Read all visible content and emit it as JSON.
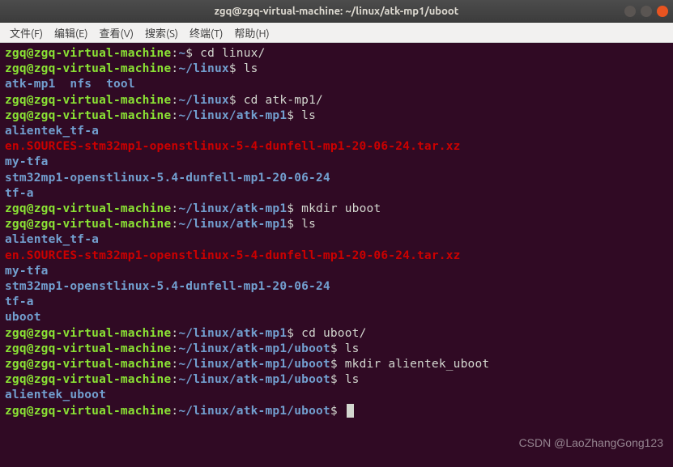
{
  "titlebar": {
    "title": "zgq@zgq-virtual-machine: ~/linux/atk-mp1/uboot"
  },
  "menubar": {
    "items": [
      "文件(F)",
      "编辑(E)",
      "查看(V)",
      "搜索(S)",
      "终端(T)",
      "帮助(H)"
    ]
  },
  "prompt": {
    "userhost": "zgq@zgq-virtual-machine",
    "sep": ":",
    "dollar": "$"
  },
  "paths": {
    "home": "~",
    "linux": "~/linux",
    "atkmp1": "~/linux/atk-mp1",
    "uboot": "~/linux/atk-mp1/uboot"
  },
  "cmds": {
    "cd_linux": "cd linux/",
    "ls": "ls",
    "cd_atkmp1": "cd atk-mp1/",
    "mkdir_uboot": "mkdir uboot",
    "cd_uboot": "cd uboot/",
    "mkdir_alientek_uboot": "mkdir alientek_uboot"
  },
  "listings": {
    "linux": {
      "d0": "atk-mp1",
      "d1": "nfs",
      "d2": "tool"
    },
    "atkmp1_before": {
      "d0": "alientek_tf-a",
      "a0": "en.SOURCES-stm32mp1-openstlinux-5-4-dunfell-mp1-20-06-24.tar.xz",
      "d1": "my-tfa",
      "d2": "stm32mp1-openstlinux-5.4-dunfell-mp1-20-06-24",
      "d3": "tf-a"
    },
    "atkmp1_after": {
      "d0": "alientek_tf-a",
      "a0": "en.SOURCES-stm32mp1-openstlinux-5-4-dunfell-mp1-20-06-24.tar.xz",
      "d1": "my-tfa",
      "d2": "stm32mp1-openstlinux-5.4-dunfell-mp1-20-06-24",
      "d3": "tf-a",
      "d4": "uboot"
    },
    "uboot": {
      "d0": "alientek_uboot"
    }
  },
  "watermark": "CSDN @LaoZhangGong123"
}
